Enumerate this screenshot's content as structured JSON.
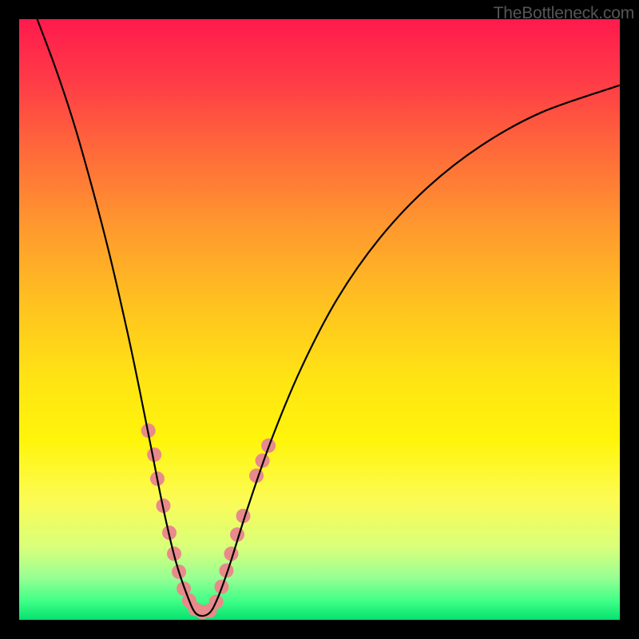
{
  "watermark": "TheBottleneck.com",
  "chart_data": {
    "type": "line",
    "title": "",
    "xlabel": "",
    "ylabel": "",
    "xlim": [
      0,
      100
    ],
    "ylim": [
      0,
      100
    ],
    "grid": false,
    "curve": [
      {
        "x": 3.0,
        "y": 100.0
      },
      {
        "x": 6.0,
        "y": 92.0
      },
      {
        "x": 9.0,
        "y": 83.0
      },
      {
        "x": 12.0,
        "y": 72.5
      },
      {
        "x": 15.0,
        "y": 61.0
      },
      {
        "x": 18.0,
        "y": 48.0
      },
      {
        "x": 20.0,
        "y": 38.5
      },
      {
        "x": 22.0,
        "y": 28.5
      },
      {
        "x": 24.0,
        "y": 18.5
      },
      {
        "x": 26.0,
        "y": 10.0
      },
      {
        "x": 28.0,
        "y": 4.0
      },
      {
        "x": 29.5,
        "y": 1.0
      },
      {
        "x": 31.5,
        "y": 1.0
      },
      {
        "x": 33.0,
        "y": 3.5
      },
      {
        "x": 35.0,
        "y": 9.0
      },
      {
        "x": 38.0,
        "y": 18.5
      },
      {
        "x": 42.0,
        "y": 30.0
      },
      {
        "x": 47.0,
        "y": 42.0
      },
      {
        "x": 53.0,
        "y": 53.5
      },
      {
        "x": 60.0,
        "y": 63.5
      },
      {
        "x": 68.0,
        "y": 72.0
      },
      {
        "x": 77.0,
        "y": 79.0
      },
      {
        "x": 87.0,
        "y": 84.5
      },
      {
        "x": 100.0,
        "y": 89.0
      }
    ],
    "scatter": [
      {
        "x": 21.5,
        "y": 31.5
      },
      {
        "x": 22.5,
        "y": 27.5
      },
      {
        "x": 23.0,
        "y": 23.5
      },
      {
        "x": 24.0,
        "y": 19.0
      },
      {
        "x": 25.0,
        "y": 14.5
      },
      {
        "x": 25.8,
        "y": 11.0
      },
      {
        "x": 26.6,
        "y": 8.0
      },
      {
        "x": 27.4,
        "y": 5.2
      },
      {
        "x": 28.3,
        "y": 3.2
      },
      {
        "x": 29.3,
        "y": 1.8
      },
      {
        "x": 30.5,
        "y": 1.3
      },
      {
        "x": 31.7,
        "y": 1.5
      },
      {
        "x": 32.8,
        "y": 3.0
      },
      {
        "x": 33.7,
        "y": 5.5
      },
      {
        "x": 34.5,
        "y": 8.2
      },
      {
        "x": 35.3,
        "y": 11.0
      },
      {
        "x": 36.3,
        "y": 14.2
      },
      {
        "x": 37.3,
        "y": 17.3
      },
      {
        "x": 39.5,
        "y": 24.0
      },
      {
        "x": 40.5,
        "y": 26.5
      },
      {
        "x": 41.5,
        "y": 29.0
      }
    ],
    "scatter_color": "#e88a8a",
    "scatter_radius": 9
  }
}
